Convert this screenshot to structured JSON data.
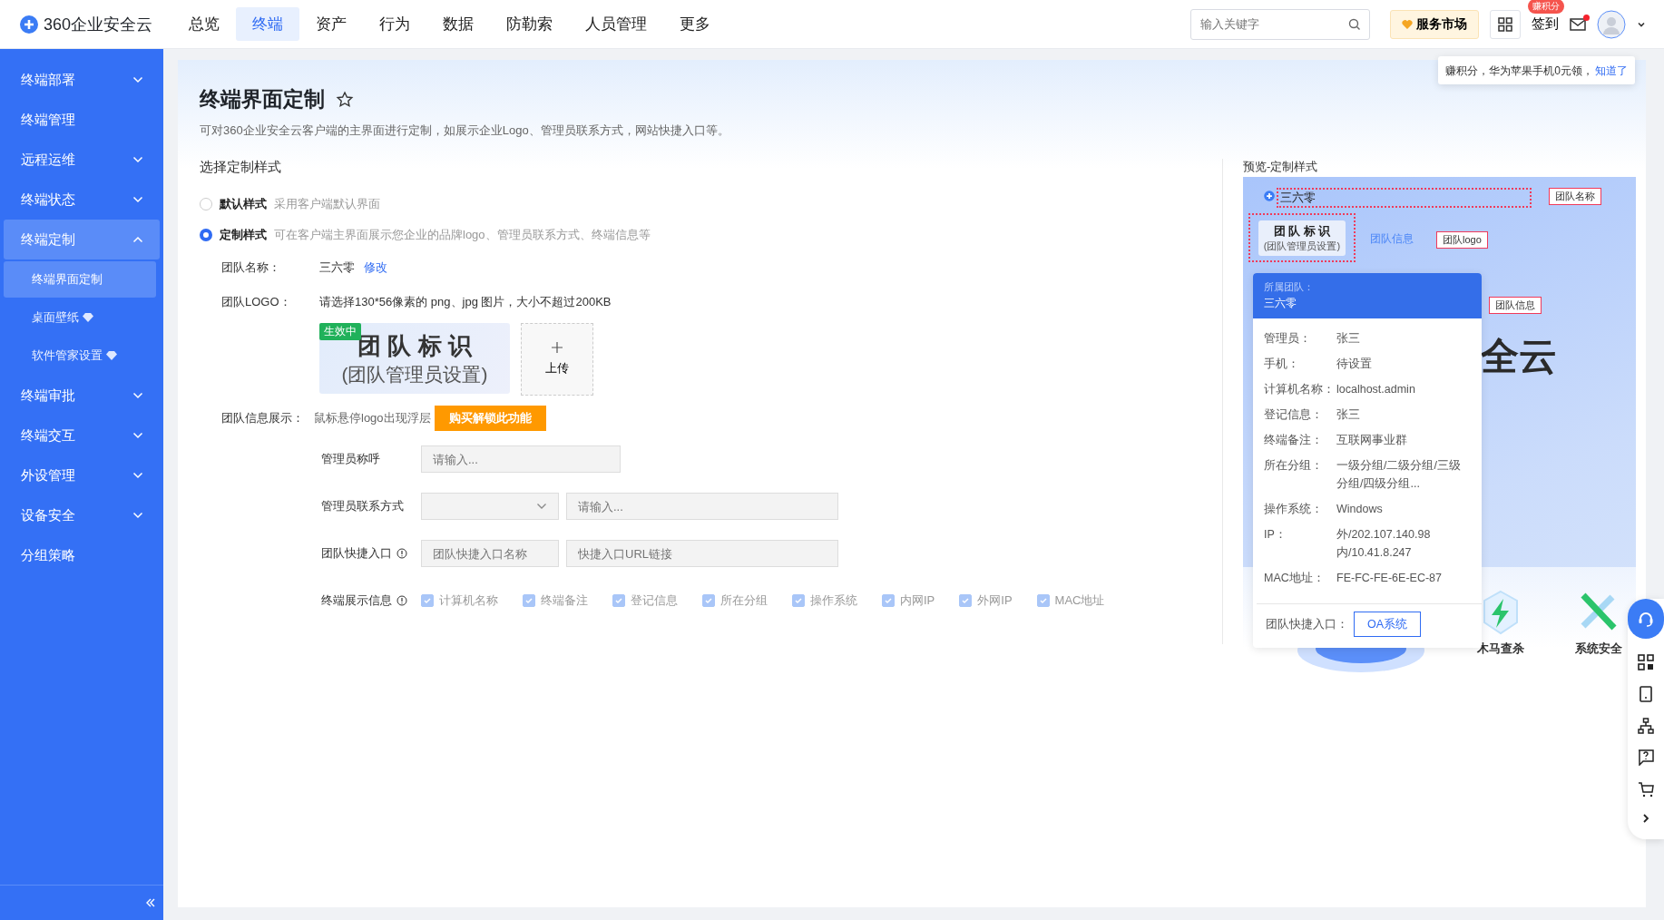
{
  "header": {
    "brand": "360企业安全云",
    "nav": [
      {
        "label": "总览",
        "selected": false
      },
      {
        "label": "终端",
        "selected": true
      },
      {
        "label": "资产",
        "selected": false
      },
      {
        "label": "行为",
        "selected": false
      },
      {
        "label": "数据",
        "selected": false
      },
      {
        "label": "防勒索",
        "selected": false
      },
      {
        "label": "人员管理",
        "selected": false
      },
      {
        "label": "更多",
        "selected": false
      }
    ],
    "search": {
      "placeholder": "输入关键字"
    },
    "market": "服务市场",
    "checkin": "签到",
    "checkin_badge": "赚积分",
    "mail_unread": true,
    "tip": {
      "text": "赚积分，华为苹果手机0元领，",
      "link": "知道了"
    }
  },
  "sidebar": {
    "items": [
      {
        "label": "终端部署",
        "selected": false,
        "expanded": false
      },
      {
        "label": "终端管理",
        "selected": false
      },
      {
        "label": "远程运维",
        "selected": false,
        "expanded": false
      },
      {
        "label": "终端状态",
        "selected": false,
        "expanded": false
      },
      {
        "label": "终端定制",
        "selected": true,
        "expanded": true,
        "children": [
          {
            "label": "终端界面定制",
            "selected": true,
            "premium": false
          },
          {
            "label": "桌面壁纸",
            "selected": false,
            "premium": true
          },
          {
            "label": "软件管家设置",
            "selected": false,
            "premium": true
          }
        ]
      },
      {
        "label": "终端审批",
        "selected": false,
        "expanded": false
      },
      {
        "label": "终端交互",
        "selected": false,
        "expanded": false
      },
      {
        "label": "外设管理",
        "selected": false,
        "expanded": false
      },
      {
        "label": "设备安全",
        "selected": false,
        "expanded": false
      },
      {
        "label": "分组策略",
        "selected": false
      }
    ]
  },
  "page": {
    "title": "终端界面定制",
    "favorite": false,
    "description": "可对360企业安全云客户端的主界面进行定制，如展示企业Logo、管理员联系方式，网站快捷入口等。",
    "section": "选择定制样式",
    "styles": [
      {
        "label": "默认样式",
        "hint": "采用客户端默认界面",
        "selected": false
      },
      {
        "label": "定制样式",
        "hint": "可在客户端主界面展示您企业的品牌logo、管理员联系方式、终端信息等",
        "selected": true
      }
    ],
    "team_name": {
      "label": "团队名称：",
      "value": "三六零",
      "action": "修改"
    },
    "team_logo": {
      "label": "团队LOGO：",
      "hint": "请选择130*56像素的 png、jpg 图片，大小不超过200KB",
      "badge": "生效中",
      "logo_title": "团 队 标 识",
      "logo_subtitle": "(团队管理员设置)",
      "upload": "上传"
    },
    "team_info": {
      "label": "团队信息展示：",
      "hint": "鼠标悬停logo出现浮层",
      "unlock": "购买解锁此功能",
      "admin_name": {
        "label": "管理员称呼",
        "placeholder": "请输入..."
      },
      "admin_contact": {
        "label": "管理员联系方式",
        "placeholder": "请输入..."
      },
      "shortcut": {
        "label": "团队快捷入口",
        "name_placeholder": "团队快捷入口名称",
        "url_placeholder": "快捷入口URL链接"
      },
      "display": {
        "label": "终端展示信息",
        "options": [
          {
            "label": "计算机名称",
            "checked": true
          },
          {
            "label": "终端备注",
            "checked": true
          },
          {
            "label": "登记信息",
            "checked": true
          },
          {
            "label": "所在分组",
            "checked": true
          },
          {
            "label": "操作系统",
            "checked": true
          },
          {
            "label": "内网IP",
            "checked": true
          },
          {
            "label": "外网IP",
            "checked": true
          },
          {
            "label": "MAC地址",
            "checked": true
          }
        ]
      }
    }
  },
  "preview": {
    "title": "预览-定制样式",
    "team_name": "三六零",
    "name_tag": "团队名称",
    "logo_title": "团 队 标 识",
    "logo_subtitle": "(团队管理员设置)",
    "info_link": "团队信息",
    "logo_tag": "团队logo",
    "info_tag": "团队信息",
    "big_text": "全云",
    "popover": {
      "team_label": "所属团队：",
      "team": "三六零",
      "rows": [
        {
          "label": "管理员：",
          "value": "张三"
        },
        {
          "label": "手机：",
          "value": "待设置"
        },
        {
          "label": "计算机名称：",
          "value": "localhost.admin"
        },
        {
          "label": "登记信息：",
          "value": "张三"
        },
        {
          "label": "终端备注：",
          "value": "互联网事业群"
        },
        {
          "label": "所在分组：",
          "value": "一级分组/二级分组/三级分组/四级分组..."
        },
        {
          "label": "操作系统：",
          "value": "Windows"
        },
        {
          "label": "IP：",
          "value": "外/202.107.140.98\n内/10.41.8.247"
        },
        {
          "label": "MAC地址：",
          "value": "FE-FC-FE-6E-EC-87"
        }
      ],
      "shortcut_label": "团队快捷入口：",
      "shortcut": "OA系统"
    },
    "features": [
      {
        "kind": "trojan",
        "label": "木马查杀"
      },
      {
        "kind": "system",
        "label": "系统安全"
      }
    ]
  }
}
